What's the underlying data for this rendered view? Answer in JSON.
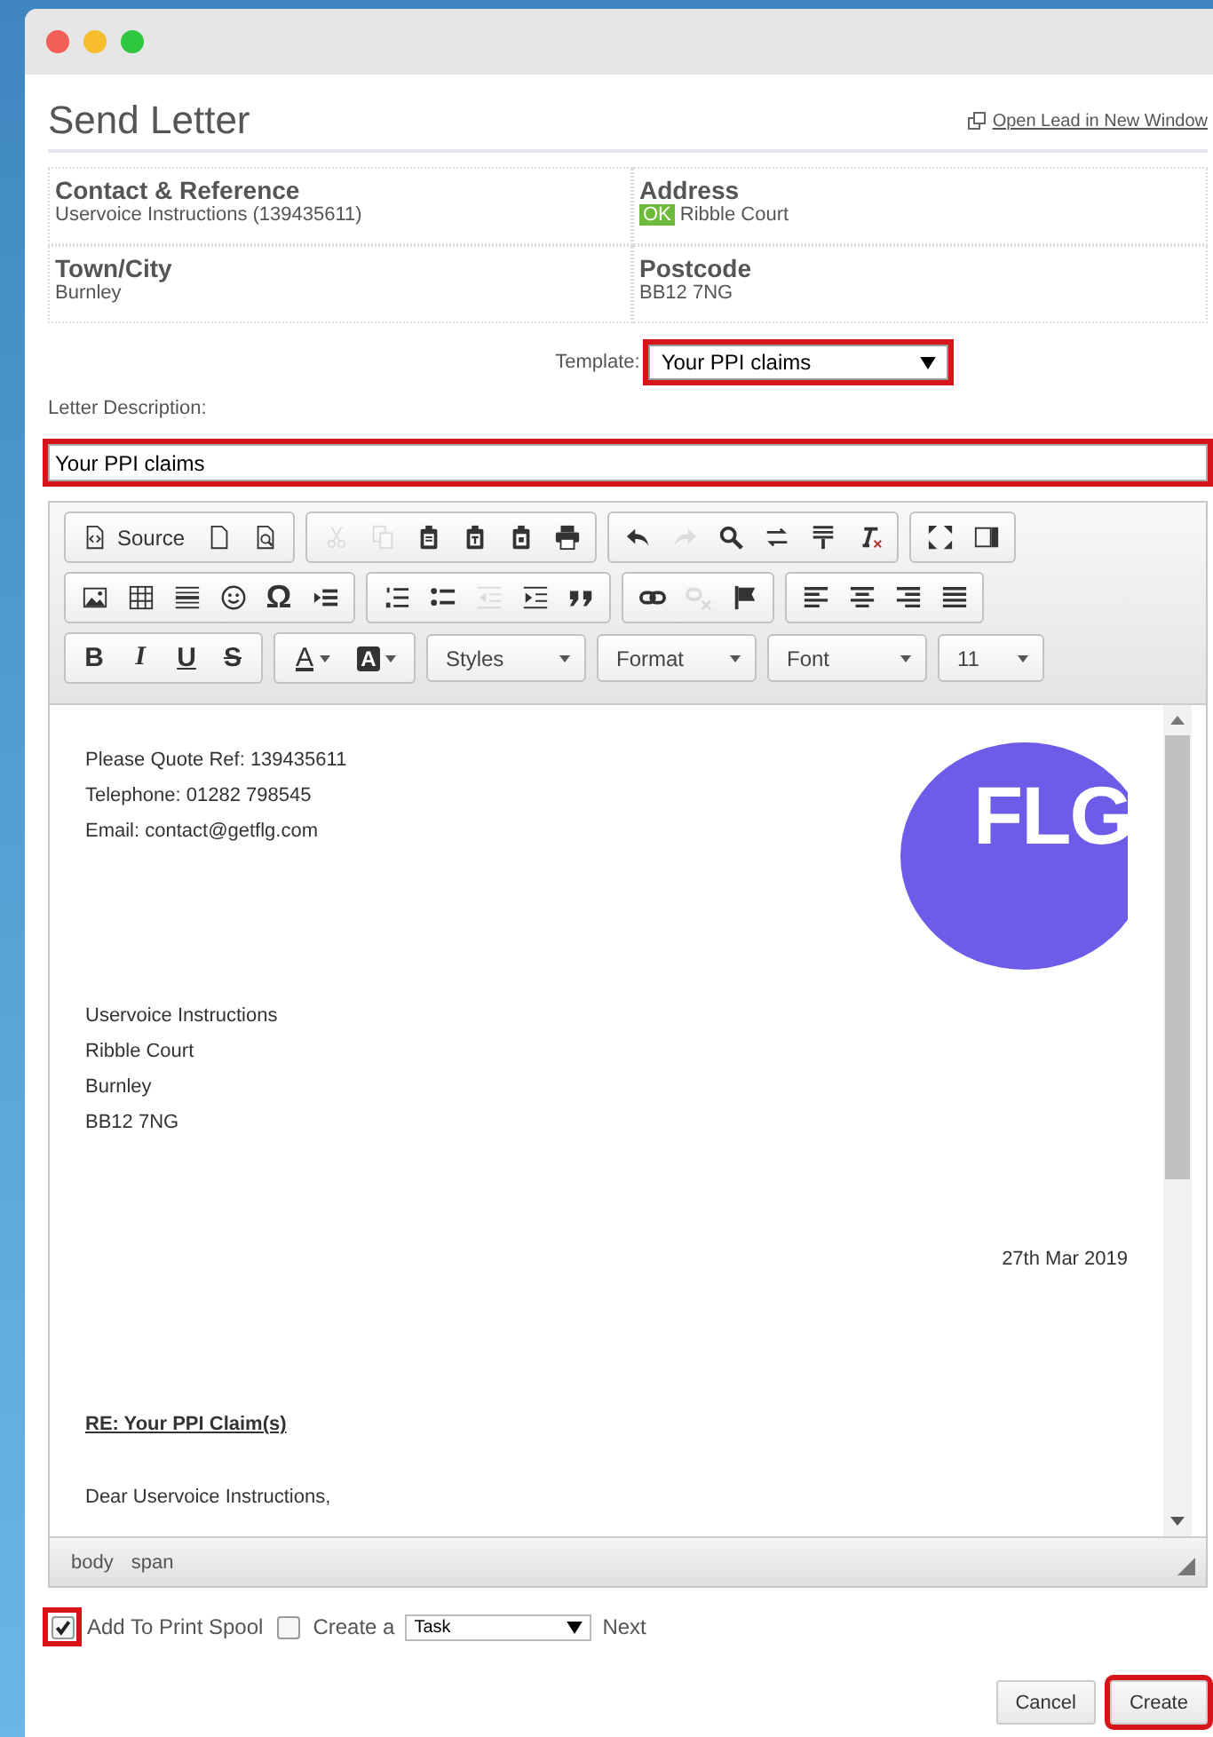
{
  "window": {
    "title": "Send Letter",
    "open_link": "Open Lead in New Window"
  },
  "details": [
    {
      "label": "Contact & Reference",
      "value": "Uservoice Instructions (139435611)"
    },
    {
      "label": "Address",
      "badge": "OK",
      "value": "Ribble Court"
    },
    {
      "label": "Town/City",
      "value": "Burnley"
    },
    {
      "label": "Postcode",
      "value": "BB12 7NG"
    }
  ],
  "template": {
    "label": "Template:",
    "value": "Your PPI claims",
    "highlighted": true
  },
  "description": {
    "label": "Letter Description:",
    "value": "Your PPI claims",
    "highlighted": true
  },
  "toolbar": [
    [
      [
        {
          "kind": "labeled",
          "label": "Source"
        },
        {
          "kind": "icon",
          "disabled": false
        },
        {
          "kind": "icon",
          "disabled": false
        }
      ],
      [
        {
          "kind": "icon",
          "disabled": true
        },
        {
          "kind": "icon",
          "disabled": true
        },
        {
          "kind": "icon",
          "disabled": false
        },
        {
          "kind": "icon",
          "disabled": false
        },
        {
          "kind": "icon",
          "disabled": false
        },
        {
          "kind": "icon",
          "disabled": false
        }
      ],
      [
        {
          "kind": "icon",
          "disabled": false
        },
        {
          "kind": "icon",
          "disabled": true
        },
        {
          "kind": "icon",
          "disabled": false
        },
        {
          "kind": "icon",
          "disabled": false
        },
        {
          "kind": "icon",
          "disabled": false
        },
        {
          "kind": "icon",
          "disabled": false
        }
      ],
      [
        {
          "kind": "icon",
          "disabled": false
        },
        {
          "kind": "icon",
          "disabled": false
        }
      ]
    ],
    [
      [
        {
          "kind": "icon",
          "disabled": false
        },
        {
          "kind": "icon",
          "disabled": false
        },
        {
          "kind": "icon",
          "disabled": false
        },
        {
          "kind": "icon",
          "disabled": false
        },
        {
          "kind": "glyph",
          "label": "Ω"
        },
        {
          "kind": "icon",
          "disabled": false
        }
      ],
      [
        {
          "kind": "icon",
          "disabled": false
        },
        {
          "kind": "icon",
          "disabled": false
        },
        {
          "kind": "icon",
          "disabled": true
        },
        {
          "kind": "icon",
          "disabled": false
        },
        {
          "kind": "icon",
          "disabled": false
        }
      ],
      [
        {
          "kind": "icon",
          "disabled": false
        },
        {
          "kind": "icon",
          "disabled": true
        },
        {
          "kind": "icon",
          "disabled": false
        }
      ],
      [
        {
          "kind": "icon",
          "disabled": false
        },
        {
          "kind": "icon",
          "disabled": false
        },
        {
          "kind": "icon",
          "disabled": false
        },
        {
          "kind": "icon",
          "disabled": false
        }
      ]
    ],
    [
      [
        {
          "kind": "glyph",
          "label": "B"
        },
        {
          "kind": "glyph",
          "label": "I"
        },
        {
          "kind": "glyph",
          "label": "U"
        },
        {
          "kind": "glyph",
          "label": "S"
        }
      ],
      [
        {
          "kind": "color",
          "label": "A"
        },
        {
          "kind": "background",
          "label": "A"
        }
      ],
      [
        {
          "kind": "combo",
          "label": "Styles"
        }
      ],
      [
        {
          "kind": "combo",
          "label": "Format"
        }
      ],
      [
        {
          "kind": "combo",
          "label": "Font"
        }
      ],
      [
        {
          "kind": "size",
          "label": "11"
        }
      ]
    ]
  ],
  "letter": {
    "header_lines": [
      "Please Quote Ref: 139435611",
      "Telephone: 01282 798545",
      "Email: contact@getflg.com"
    ],
    "logo": "FLG",
    "recipient_lines": [
      "Uservoice Instructions",
      "Ribble Court",
      "Burnley",
      "BB12 7NG"
    ],
    "date": "27th Mar 2019",
    "subject": "RE: Your PPI Claim(s)",
    "salutation": "Dear Uservoice Instructions,"
  },
  "element_path": [
    "body",
    "span"
  ],
  "options": {
    "print_spool": {
      "label": "Add To Print Spool",
      "checked": true,
      "highlighted": true
    },
    "create": {
      "label": "Create a",
      "checked": false,
      "highlighted": false
    },
    "type": "Task",
    "next": "Next"
  },
  "buttons": [
    {
      "label": "Cancel",
      "highlighted": false
    },
    {
      "label": "Create",
      "highlighted": true
    }
  ]
}
